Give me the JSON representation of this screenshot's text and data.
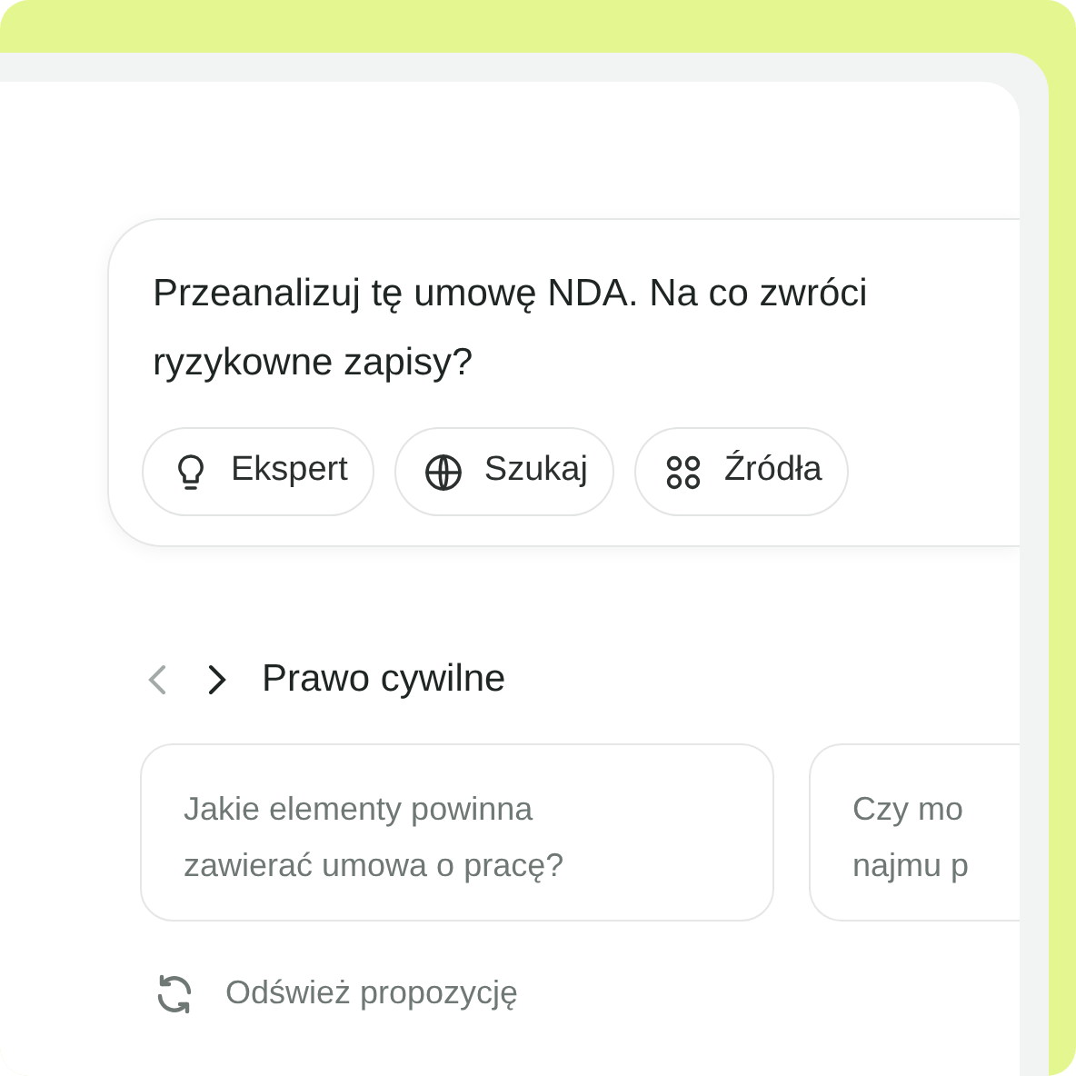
{
  "prompt": {
    "lines": [
      "Przeanalizuj tę umowę NDA. Na co zwróci",
      "ryzykowne zapisy?"
    ],
    "chips": [
      {
        "kind": "bulb",
        "label": "Ekspert"
      },
      {
        "kind": "globe",
        "label": "Szukaj"
      },
      {
        "kind": "grid",
        "label": "Źródła"
      }
    ]
  },
  "category": {
    "prev_disabled": true,
    "next_disabled": false,
    "title": "Prawo cywilne"
  },
  "suggestions": [
    {
      "lines": [
        "Jakie elementy powinna",
        "zawierać umowa o pracę?"
      ]
    },
    {
      "lines": [
        "Czy mo",
        "najmu p"
      ]
    }
  ],
  "refresh": {
    "label": "Odśwież propozycję"
  }
}
